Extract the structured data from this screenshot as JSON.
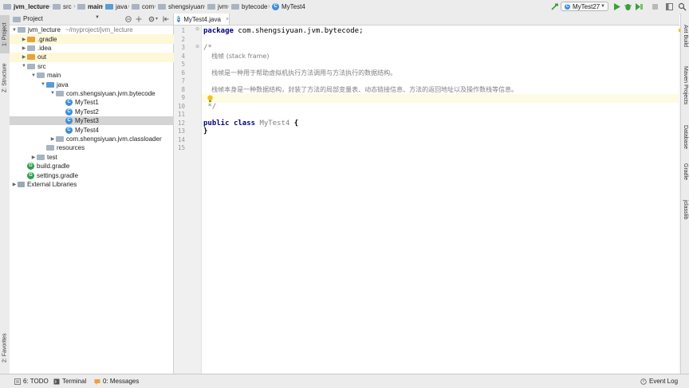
{
  "breadcrumbs": [
    "jvm_lecture",
    "src",
    "main",
    "java",
    "com",
    "shengsiyuan",
    "jvm",
    "bytecode",
    "MyTest4"
  ],
  "run_config": "MyTest27",
  "left_tabs": [
    "1: Project",
    "Z: Structure",
    "2: Favorites"
  ],
  "project_panel": {
    "title": "Project",
    "tree": [
      {
        "label": "jvm_lecture",
        "hint": "~/myproject/jvm_lecture"
      },
      {
        "label": ".gradle"
      },
      {
        "label": ".idea"
      },
      {
        "label": "out"
      },
      {
        "label": "src"
      },
      {
        "label": "main"
      },
      {
        "label": "java"
      },
      {
        "label": "com.shengsiyuan.jvm.bytecode"
      },
      {
        "label": "MyTest1"
      },
      {
        "label": "MyTest2"
      },
      {
        "label": "MyTest3"
      },
      {
        "label": "MyTest4"
      },
      {
        "label": "com.shengsiyuan.jvm.classloader"
      },
      {
        "label": "resources"
      },
      {
        "label": "test"
      },
      {
        "label": "build.gradle"
      },
      {
        "label": "settings.gradle"
      },
      {
        "label": "External Libraries"
      }
    ]
  },
  "editor": {
    "tab_label": "MyTest4.java",
    "line_numbers": [
      "1",
      "2",
      "3",
      "4",
      "5",
      "6",
      "7",
      "8",
      "9",
      "10",
      "11",
      "12",
      "13",
      "14",
      "15"
    ],
    "code": {
      "l1_kw": "package",
      "l1_rest": " com.shengsiyuan.jvm.bytecode;",
      "l3": "/*",
      "l4": "    栈帧 (stack frame)",
      "l6": "    栈帧是一种用于帮助虚拟机执行方法调用与方法执行的数据结构。",
      "l8": "    栈帧本身是一种数据结构，封装了方法的局部变量表、动态链接信息、方法的返回地址以及操作数栈等信息。",
      "l11": " */",
      "l13_kw1": "public",
      "l13_kw2": "class",
      "l13_name": "MyTest4",
      "l13_brace": " {",
      "l14": "}"
    }
  },
  "right_tabs": [
    "Ant Build",
    "Maven Projects",
    "Database",
    "Gradle",
    "jclasslib"
  ],
  "bottom_bar": {
    "todo": "6: TODO",
    "terminal": "Terminal",
    "messages": "0: Messages",
    "event_log": "Event Log"
  },
  "colors": {
    "keyword": "#000080",
    "comment": "#808080",
    "selection": "#d4d4d4",
    "current_line": "#fdfbe4",
    "run_green": "#3a9f3a",
    "class_icon": "#3d8fd8"
  }
}
